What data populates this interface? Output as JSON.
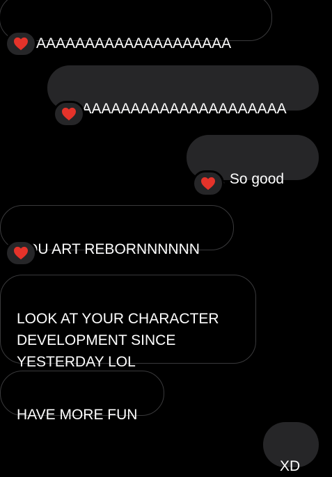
{
  "messages": [
    {
      "direction": "incoming",
      "text": "AAAAAAAAAAAAAAAAAAAAAA",
      "reaction": "heart-icon"
    },
    {
      "direction": "outgoing",
      "text": "YAAAAAAAAAAAAAAAAAAAAAA",
      "reaction": "heart-icon"
    },
    {
      "direction": "outgoing",
      "text": "It's.  So good",
      "reaction": "heart-icon"
    },
    {
      "direction": "incoming",
      "text": "YOU ART REBORNNNNNN",
      "reaction": "heart-icon"
    },
    {
      "direction": "incoming",
      "text": "LOOK AT YOUR CHARACTER\nDEVELOPMENT SINCE\nYESTERDAY LOL",
      "reaction": null
    },
    {
      "direction": "incoming",
      "text": "HAVE MORE FUN",
      "reaction": null
    },
    {
      "direction": "outgoing",
      "text": "XD",
      "reaction": null
    }
  ],
  "colors": {
    "background": "#000000",
    "incoming_border": "#3a3a3c",
    "outgoing_fill": "#262628",
    "heart": "#e5332a"
  }
}
